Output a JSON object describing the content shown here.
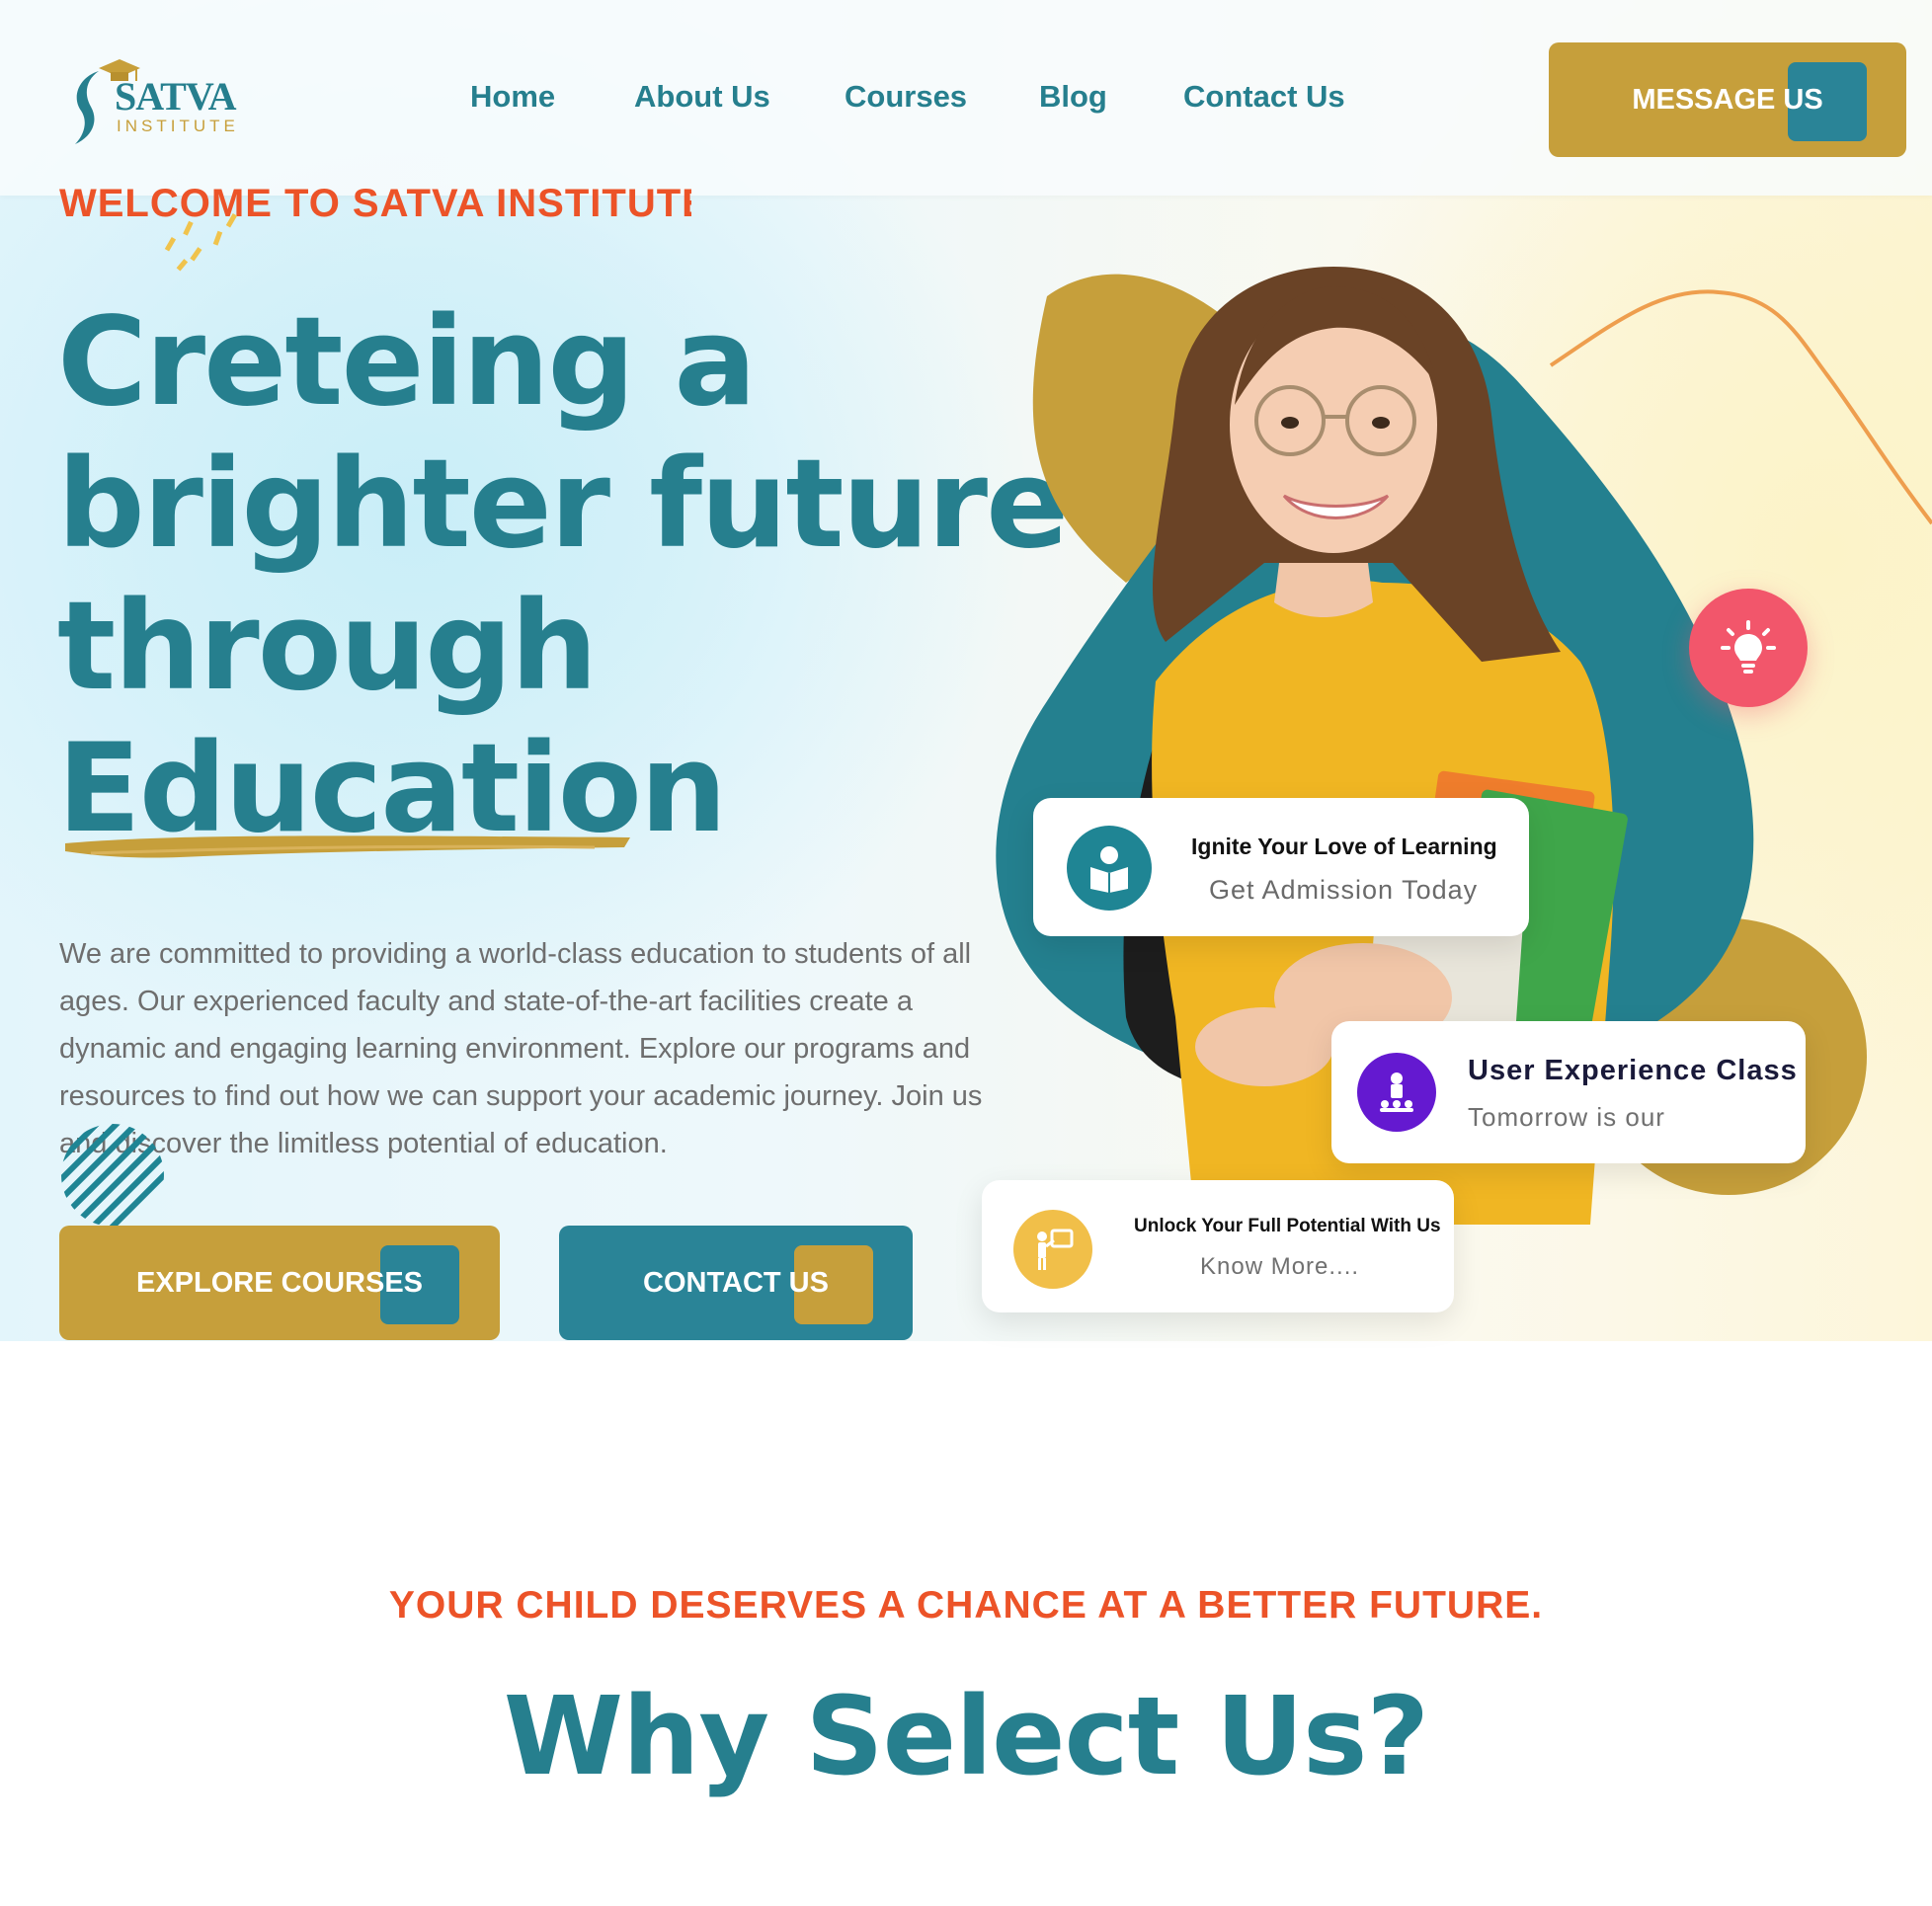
{
  "brand": {
    "name": "SATVA",
    "subtitle": "INSTITUTE"
  },
  "nav": {
    "items": [
      "Home",
      "About Us",
      "Courses",
      "Blog",
      "Contact Us"
    ]
  },
  "header": {
    "cta_label": "MESSAGE US"
  },
  "hero": {
    "eyebrow": "WELCOME TO SATVA INSTITUTE",
    "headline_lines": [
      "Creteing a",
      "brighter future",
      "through",
      "Education"
    ],
    "description": "We are committed to providing a world-class education to students of all ages. Our experienced faculty and state-of-the-art facilities create a dynamic and engaging learning environment. Explore our programs and resources to find out how we can support your academic journey. Join us and discover the limitless potential of education.",
    "buttons": {
      "explore": "EXPLORE COURSES",
      "contact": "CONTACT US"
    }
  },
  "cards": {
    "card1": {
      "title": "Ignite Your Love of Learning",
      "subtitle": "Get Admission Today",
      "icon": "reading-student-icon"
    },
    "card2": {
      "title": "User Experience Class",
      "subtitle": "Tomorrow is our",
      "icon": "teacher-class-icon"
    },
    "card3": {
      "title": "Unlock Your Full Potential With Us",
      "subtitle": "Know More....",
      "icon": "presenter-board-icon"
    }
  },
  "icons": {
    "bulb": "lightbulb-icon"
  },
  "section_why": {
    "subheading": "YOUR CHILD DESERVES A CHANCE AT A BETTER FUTURE.",
    "title": "Why Select Us?"
  },
  "colors": {
    "teal": "#267f8e",
    "gold": "#c69f3b",
    "orange_red": "#ec5328",
    "coral": "#f2566b",
    "purple": "#6419d0",
    "yellow_shirt": "#f0b623"
  }
}
